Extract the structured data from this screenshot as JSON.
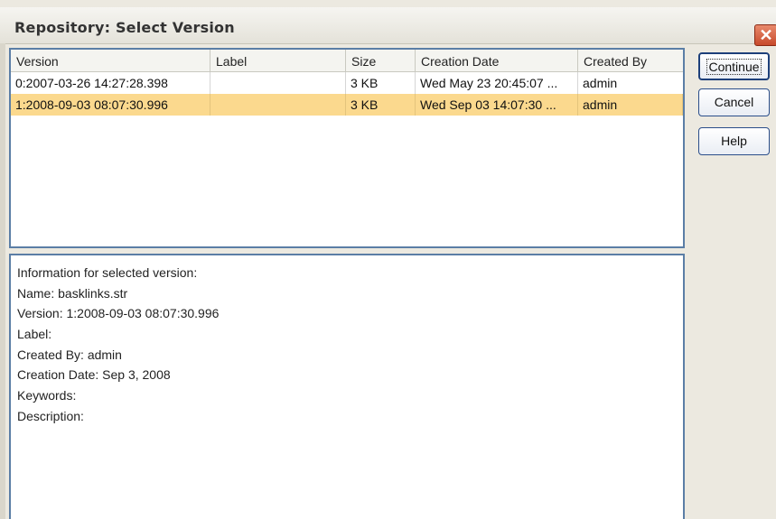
{
  "window": {
    "title": "Repository: Select Version",
    "close_glyph": "✕"
  },
  "table": {
    "columns": [
      "Version",
      "Label",
      "Size",
      "Creation Date",
      "Created By"
    ],
    "rows": [
      {
        "version": "0:2007-03-26 14:27:28.398",
        "label": "",
        "size": "3 KB",
        "date": "Wed May 23 20:45:07 ...",
        "by": "admin",
        "selected": false
      },
      {
        "version": "1:2008-09-03 08:07:30.996",
        "label": "",
        "size": "3 KB",
        "date": "Wed Sep 03 14:07:30 ...",
        "by": "admin",
        "selected": true
      }
    ],
    "selection_color": "#fbd98e"
  },
  "info": {
    "lines": [
      "Information for selected version:",
      "Name: basklinks.str",
      "Version: 1:2008-09-03 08:07:30.996",
      "Label:",
      "Created By: admin",
      "Creation Date: Sep 3, 2008",
      "Keywords:",
      "Description:"
    ]
  },
  "buttons": {
    "continue": "Continue",
    "cancel": "Cancel",
    "help": "Help"
  }
}
